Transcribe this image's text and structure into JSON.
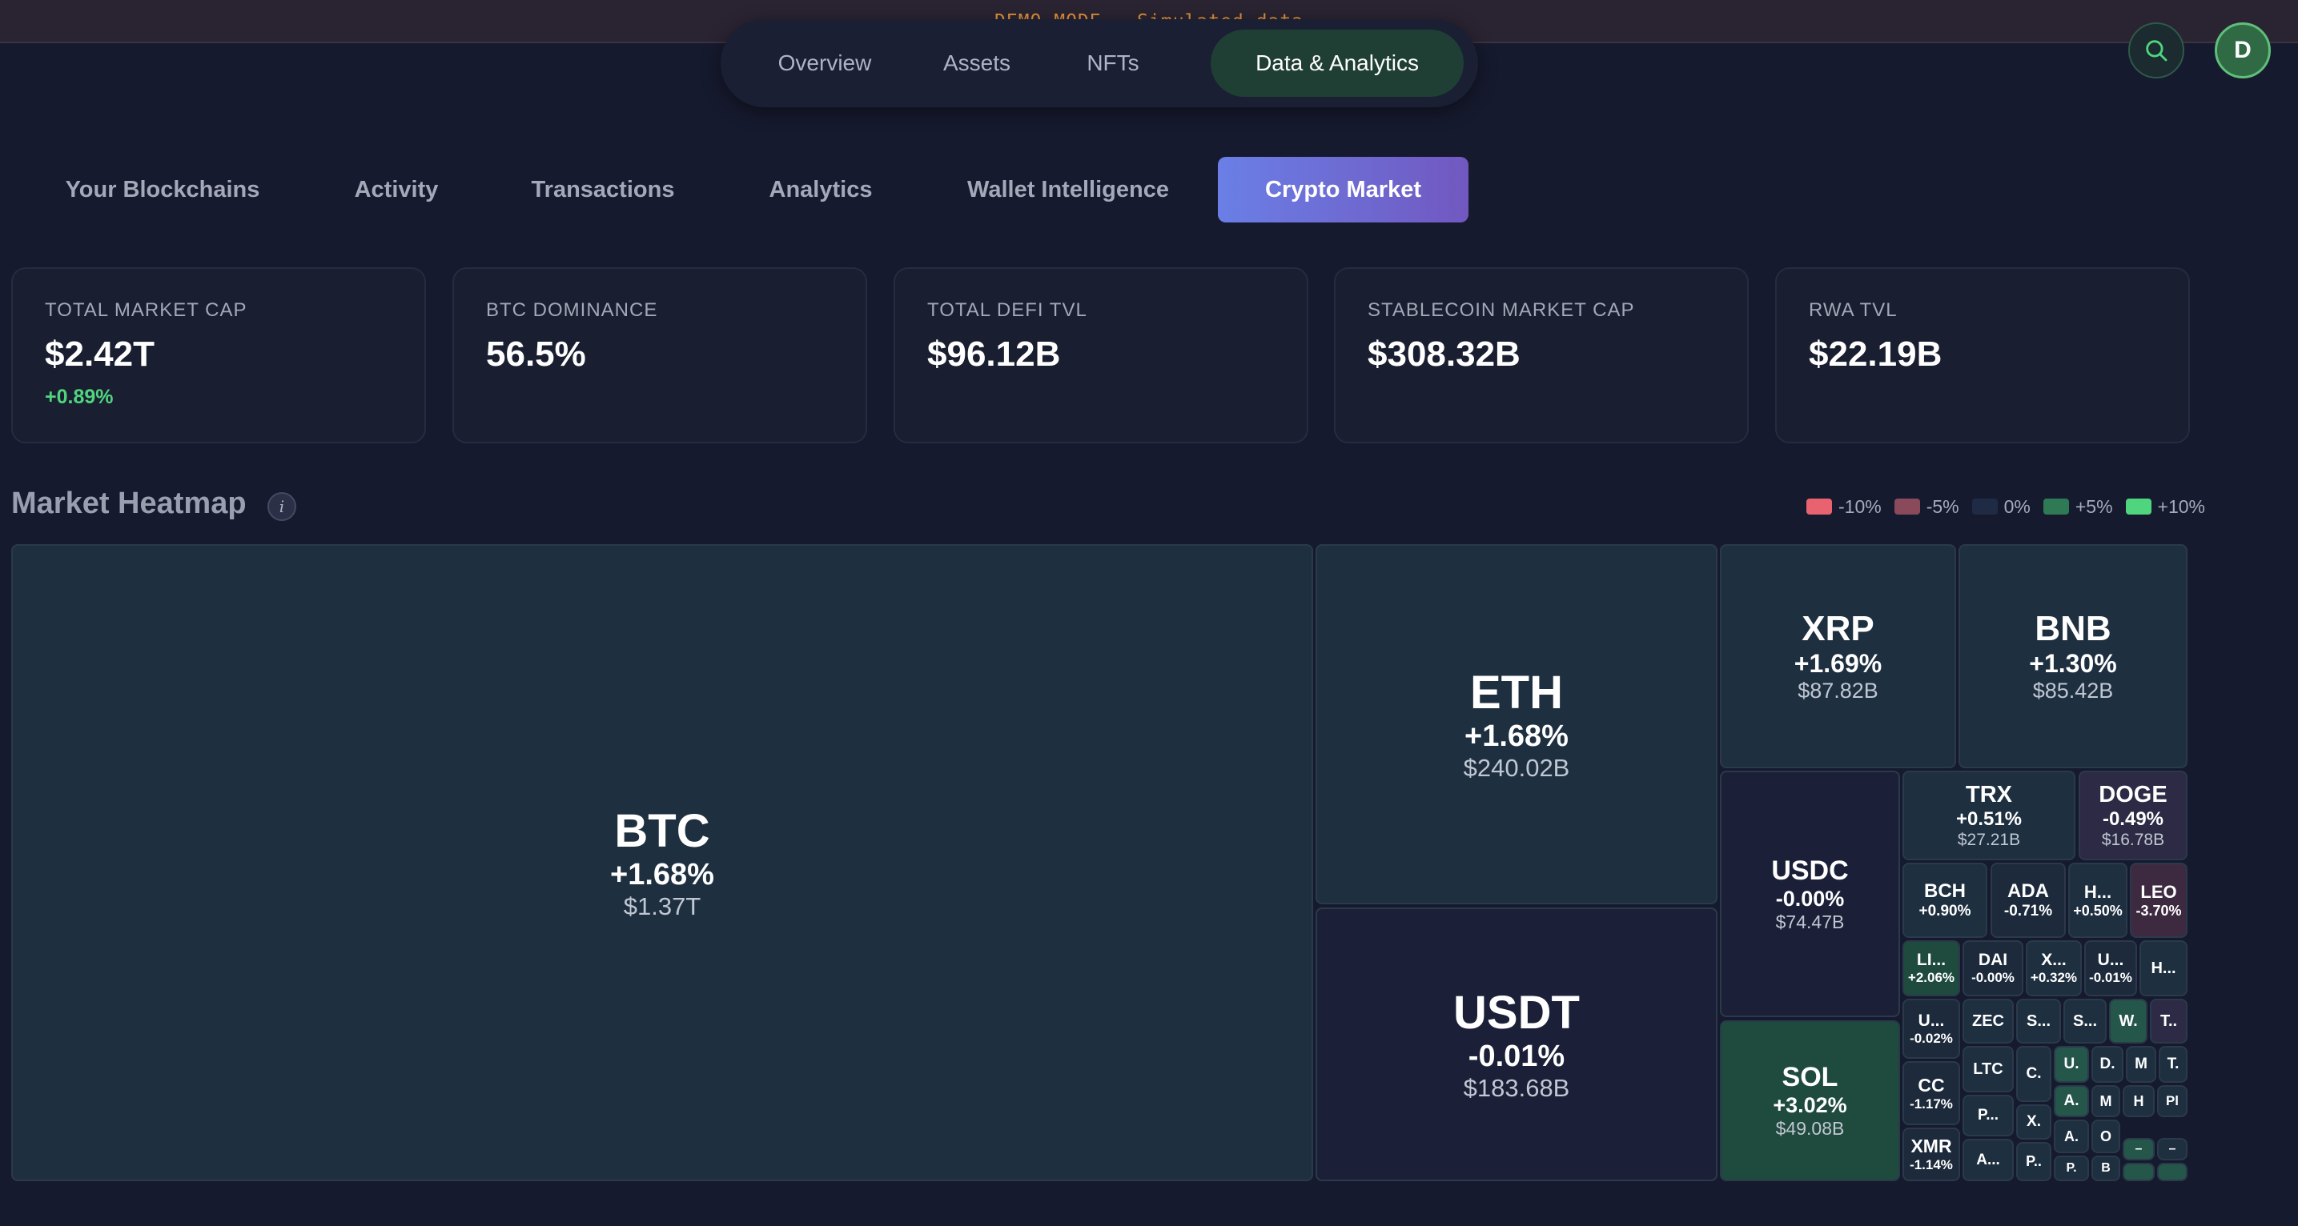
{
  "demo_banner": "DEMO MODE - Simulated data",
  "main_nav": {
    "items": [
      {
        "label": "Overview"
      },
      {
        "label": "Assets"
      },
      {
        "label": "NFTs"
      },
      {
        "label": "Data & Analytics"
      }
    ],
    "active": "Data & Analytics"
  },
  "header_icons": {
    "search": "search-icon",
    "avatar_initial": "D"
  },
  "sub_tabs": {
    "items": [
      {
        "label": "Your Blockchains"
      },
      {
        "label": "Activity"
      },
      {
        "label": "Transactions"
      },
      {
        "label": "Analytics"
      },
      {
        "label": "Wallet Intelligence"
      },
      {
        "label": "Crypto Market"
      }
    ],
    "active": "Crypto Market"
  },
  "stats": [
    {
      "label": "TOTAL MARKET CAP",
      "value": "$2.42T",
      "change": "+0.89%"
    },
    {
      "label": "BTC DOMINANCE",
      "value": "56.5%"
    },
    {
      "label": "TOTAL DEFI TVL",
      "value": "$96.12B"
    },
    {
      "label": "STABLECOIN MARKET CAP",
      "value": "$308.32B"
    },
    {
      "label": "RWA TVL",
      "value": "$22.19B"
    }
  ],
  "heatmap": {
    "title": "Market Heatmap",
    "info_icon": "i",
    "legend": [
      {
        "label": "-10%",
        "color": "#e8636f"
      },
      {
        "label": "-5%",
        "color": "#8a4a5c"
      },
      {
        "label": "0%",
        "color": "#1f2b45"
      },
      {
        "label": "+5%",
        "color": "#2f7a55"
      },
      {
        "label": "+10%",
        "color": "#4fd57e"
      }
    ],
    "tiles": [
      {
        "symbol": "BTC",
        "change": "+1.68%",
        "cap": "$1.37T"
      },
      {
        "symbol": "ETH",
        "change": "+1.68%",
        "cap": "$240.02B"
      },
      {
        "symbol": "USDT",
        "change": "-0.01%",
        "cap": "$183.68B"
      },
      {
        "symbol": "XRP",
        "change": "+1.69%",
        "cap": "$87.82B"
      },
      {
        "symbol": "BNB",
        "change": "+1.30%",
        "cap": "$85.42B"
      },
      {
        "symbol": "USDC",
        "change": "-0.00%",
        "cap": "$74.47B"
      },
      {
        "symbol": "SOL",
        "change": "+3.02%",
        "cap": "$49.08B"
      },
      {
        "symbol": "TRX",
        "change": "+0.51%",
        "cap": "$27.21B"
      },
      {
        "symbol": "DOGE",
        "change": "-0.49%",
        "cap": "$16.78B"
      },
      {
        "symbol": "BCH",
        "change": "+0.90%"
      },
      {
        "symbol": "ADA",
        "change": "-0.71%"
      },
      {
        "symbol": "H...",
        "change": "+0.50%"
      },
      {
        "symbol": "LEO",
        "change": "-3.70%"
      },
      {
        "symbol": "LI...",
        "change": "+2.06%"
      },
      {
        "symbol": "DAI",
        "change": "-0.00%"
      },
      {
        "symbol": "X...",
        "change": "+0.32%"
      },
      {
        "symbol": "U...",
        "change": "-0.01%"
      },
      {
        "symbol": "H..."
      },
      {
        "symbol": "U...",
        "change": "-0.02%"
      },
      {
        "symbol": "ZEC"
      },
      {
        "symbol": "S..."
      },
      {
        "symbol": "S..."
      },
      {
        "symbol": "W."
      },
      {
        "symbol": "T.."
      },
      {
        "symbol": "CC",
        "change": "-1.17%"
      },
      {
        "symbol": "LTC"
      },
      {
        "symbol": "C."
      },
      {
        "symbol": "U."
      },
      {
        "symbol": "D."
      },
      {
        "symbol": "M"
      },
      {
        "symbol": "T."
      },
      {
        "symbol": "P..."
      },
      {
        "symbol": "X."
      },
      {
        "symbol": "A."
      },
      {
        "symbol": "M"
      },
      {
        "symbol": "H"
      },
      {
        "symbol": "Pl"
      },
      {
        "symbol": "XMR",
        "change": "-1.14%"
      },
      {
        "symbol": "A..."
      },
      {
        "symbol": "P.."
      },
      {
        "symbol": "A."
      },
      {
        "symbol": "O"
      },
      {
        "symbol": "–"
      },
      {
        "symbol": "–"
      },
      {
        "symbol": "P."
      },
      {
        "symbol": "B"
      }
    ]
  }
}
